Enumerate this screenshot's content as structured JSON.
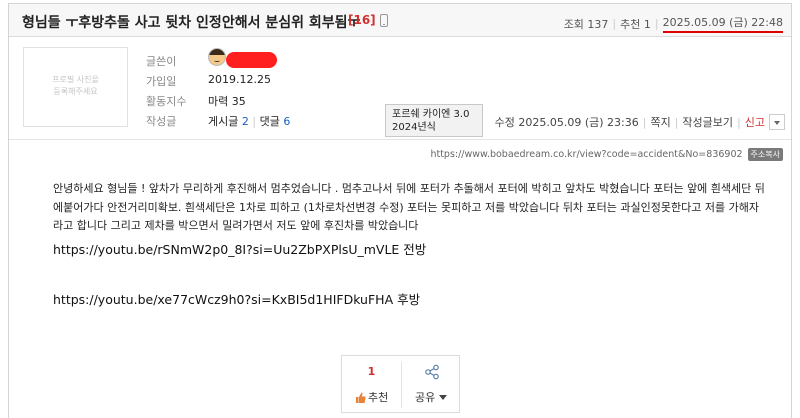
{
  "post": {
    "title": "형님들 ㅜ후방추돌 사고 뒷차 인정안해서 분심위 회부됨ㅜ",
    "comment_count_badge": "[16]",
    "views_label": "조회 137",
    "recommend_label": "추천 1",
    "date": "2025.05.09 (금) 22:48"
  },
  "author": {
    "profile_placeholder": "프로필 사진을\n등록해주세요",
    "labels": {
      "writer": "글쓴이",
      "joined": "가입일",
      "activity": "활동지수",
      "posts": "작성글"
    },
    "joined": "2019.12.25",
    "activity": "마력 35",
    "posts_label": "게시글",
    "posts_count": "2",
    "comments_label": "댓글",
    "comments_count": "6"
  },
  "tooltip": {
    "line1": "포르쉐 카이엔 3.0",
    "line2": "2024년식"
  },
  "meta": {
    "edited": "수정 2025.05.09 (금) 23:36",
    "message": "쪽지",
    "view_posts": "작성글보기",
    "report": "신고"
  },
  "url": {
    "text": "https://www.bobaedream.co.kr/view?code=accident&No=836902",
    "copy_label": "주소복사"
  },
  "content": {
    "body": "안녕하세요 형님들 ! 앞차가 무리하게 후진해서 멈추었습니다 . 멈추고나서 뒤에 포터가 추돌해서 포터에 박히고 앞차도 박혔습니다 포터는 앞에 흰색세단 뒤에붙어가다 안전거리미확보. 흰색세단은 1차로 피하고 (1차로차선변경 수정) 포터는 못피하고 저를 박았습니다 뒤차 포터는 과실인정못한다고 저를 가해자라고 합니다 그리고 제차를 박으면서  밀려가면서 저도 앞에 후진차를 박았습니다",
    "link1": "https://youtu.be/rSNmW2p0_8I?si=Uu2ZbPXPlsU_mVLE 전방",
    "link2": "https://youtu.be/xe77cWcz9h0?si=KxBI5d1HIFDkuFHA 후방"
  },
  "actions": {
    "recommend_count": "1",
    "recommend_label": "추천",
    "share_label": "공유"
  },
  "colors": {
    "accent_red": "#d32f2f",
    "link_blue": "#1a5fc9",
    "date_underline": "#e00000"
  }
}
